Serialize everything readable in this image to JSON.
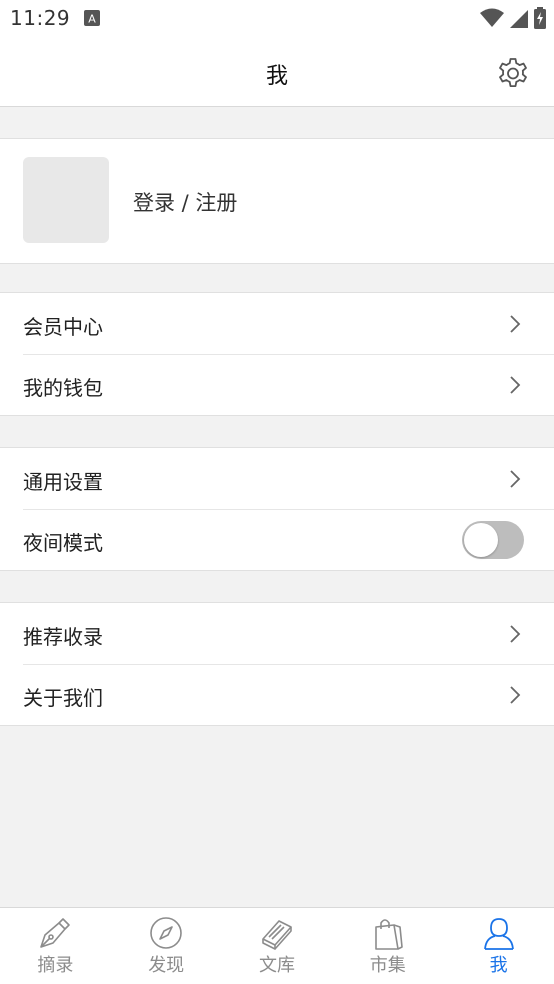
{
  "status_bar": {
    "time": "11:29"
  },
  "header": {
    "title": "我"
  },
  "profile": {
    "login_label": "登录 / 注册"
  },
  "groups": [
    {
      "items": [
        {
          "label": "会员中心"
        },
        {
          "label": "我的钱包"
        }
      ]
    },
    {
      "items": [
        {
          "label": "通用设置"
        },
        {
          "label": "夜间模式",
          "toggle": false
        }
      ]
    },
    {
      "items": [
        {
          "label": "推荐收录"
        },
        {
          "label": "关于我们"
        }
      ]
    }
  ],
  "tabs": [
    {
      "label": "摘录",
      "icon": "pen-nib-icon"
    },
    {
      "label": "发现",
      "icon": "compass-icon"
    },
    {
      "label": "文库",
      "icon": "book-icon"
    },
    {
      "label": "市集",
      "icon": "shopping-bag-icon"
    },
    {
      "label": "我",
      "icon": "person-icon",
      "active": true
    }
  ],
  "colors": {
    "accent": "#1a73e8",
    "tab_inactive": "#8c8c8c",
    "background": "#f2f2f2"
  }
}
